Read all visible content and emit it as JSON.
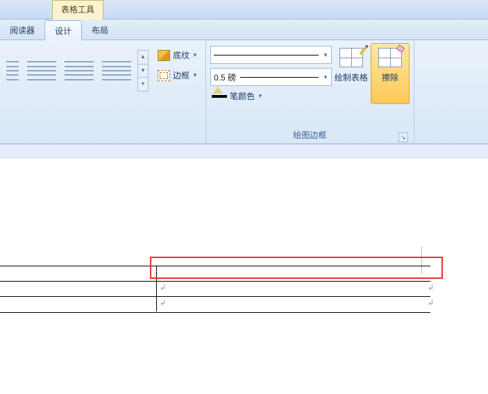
{
  "contextual_tab": "表格工具",
  "tabs": {
    "reader": "阅读器",
    "design": "设计",
    "layout": "布局"
  },
  "ribbon": {
    "shading_label": "底纹",
    "border_label": "边框",
    "pen_style_display": "",
    "pen_weight_display": "0.5 磅",
    "pen_color_label": "笔颜色",
    "draw_table_label": "绘制表格",
    "erase_label": "擦除",
    "group_draw_label": "绘图边框"
  }
}
